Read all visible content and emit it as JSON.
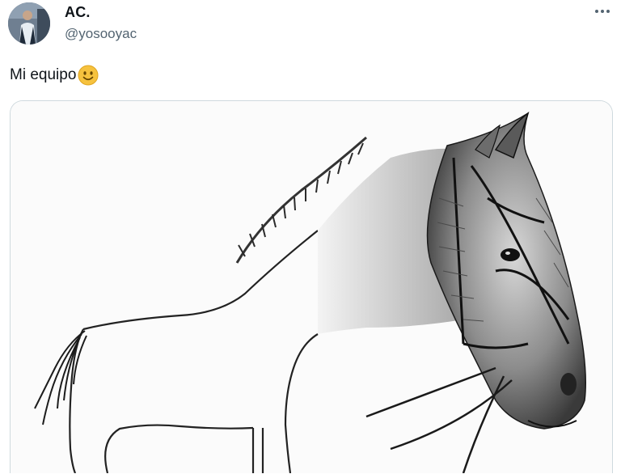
{
  "author": {
    "name": "AC.",
    "handle": "@yosooyac",
    "avatar_icon": "user-avatar"
  },
  "menu": {
    "icon": "more-horizontal-icon"
  },
  "tweet": {
    "text": "Mi equipo",
    "emoji_icon": "slightly-smiling-face-icon"
  },
  "media": {
    "description_icon": "horse-sketch-image"
  },
  "colors": {
    "text": "#0f1419",
    "secondary": "#536471",
    "border": "#cfd9de",
    "emoji": "#f6c23e"
  }
}
